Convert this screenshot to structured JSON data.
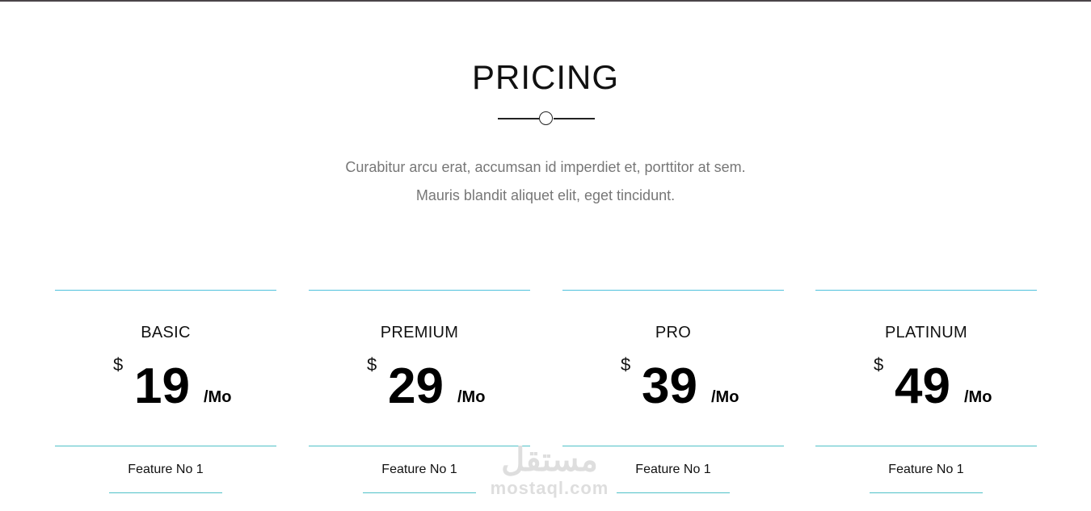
{
  "section": {
    "title": "PRICING",
    "subtitle_line1": "Curabitur arcu erat, accumsan id imperdiet et, porttitor at sem.",
    "subtitle_line2": "Mauris blandit aliquet elit, eget tincidunt."
  },
  "plans": [
    {
      "name": "BASIC",
      "currency": "$",
      "amount": "19",
      "period": "/Mo",
      "feature": "Feature No 1"
    },
    {
      "name": "PREMIUM",
      "currency": "$",
      "amount": "29",
      "period": "/Mo",
      "feature": "Feature No 1"
    },
    {
      "name": "PRO",
      "currency": "$",
      "amount": "39",
      "period": "/Mo",
      "feature": "Feature No 1"
    },
    {
      "name": "PLATINUM",
      "currency": "$",
      "amount": "49",
      "period": "/Mo",
      "feature": "Feature No 1"
    }
  ],
  "watermark": {
    "arabic": "مستقل",
    "latin": "mostaql.com"
  },
  "colors": {
    "accent_line": "#4fc1dc",
    "top_border": "#4a4448",
    "subtitle_text": "#777777"
  }
}
